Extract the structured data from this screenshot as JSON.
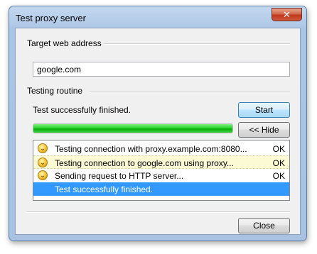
{
  "window": {
    "title": "Test proxy server",
    "close_glyph": "✕"
  },
  "target": {
    "group_label": "Target web address",
    "value": "google.com"
  },
  "routine": {
    "group_label": "Testing routine",
    "status": "Test successfully finished.",
    "start_label": "Start",
    "hide_label": "<< Hide",
    "progress": 1.0,
    "progress_color": "#06b006"
  },
  "log": {
    "rows": [
      {
        "icon": "chevron-down-icon",
        "message": "Testing connection with proxy.example.com:8080...",
        "result": "OK"
      },
      {
        "icon": "chevron-down-icon",
        "message": "Testing connection to google.com using proxy...",
        "result": "OK"
      },
      {
        "icon": "chevron-down-icon",
        "message": "Sending request to HTTP server...",
        "result": "OK"
      },
      {
        "icon": "",
        "message": "Test successfully finished.",
        "result": ""
      }
    ],
    "selected_color": "#3399ff",
    "highlight_color": "#fcfad4"
  },
  "footer": {
    "close_label": "Close"
  }
}
